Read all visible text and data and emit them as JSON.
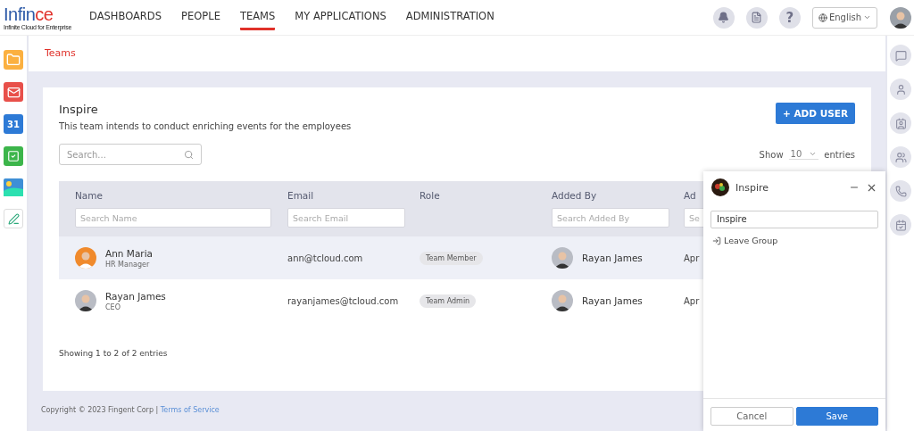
{
  "logo": {
    "main": "Infin",
    "accent": "ce",
    "tagline": "Infinite Cloud for Enterprise"
  },
  "nav": [
    {
      "label": "DASHBOARDS",
      "selected": false
    },
    {
      "label": "PEOPLE",
      "selected": false
    },
    {
      "label": "TEAMS",
      "selected": true
    },
    {
      "label": "MY APPLICATIONS",
      "selected": false
    },
    {
      "label": "ADMINISTRATION",
      "selected": false
    }
  ],
  "header_actions": {
    "help": "?",
    "language": "English"
  },
  "left_apps": [
    {
      "kind": "folder"
    },
    {
      "kind": "mail"
    },
    {
      "kind": "calendar",
      "text": "31"
    },
    {
      "kind": "tasks"
    },
    {
      "kind": "gallery"
    },
    {
      "kind": "learning"
    }
  ],
  "right_apps": [
    {
      "kind": "chat"
    },
    {
      "kind": "person"
    },
    {
      "kind": "contact"
    },
    {
      "kind": "group"
    },
    {
      "kind": "phone"
    },
    {
      "kind": "calendar"
    }
  ],
  "breadcrumb": "Teams",
  "team": {
    "name": "Inspire",
    "description": "This team intends to conduct enriching events for the employees"
  },
  "add_button": "+ ADD USER",
  "search": {
    "placeholder": "Search..."
  },
  "page_size": {
    "before": "Show",
    "value": "10",
    "after": "entries"
  },
  "table": {
    "columns": [
      {
        "label": "Name",
        "filter": "Search Name"
      },
      {
        "label": "Email",
        "filter": "Search Email"
      },
      {
        "label": "Role"
      },
      {
        "label": "Added By",
        "filter": "Search Added By"
      },
      {
        "label": "Ad",
        "filter": "Se"
      }
    ],
    "rows": [
      {
        "name": "Ann Maria",
        "title": "HR Manager",
        "email": "ann@tcloud.com",
        "role": "Team Member",
        "added_by": "Rayan James",
        "column_5": "Apr",
        "selected": true
      },
      {
        "name": "Rayan James",
        "title": "CEO",
        "email": "rayanjames@tcloud.com",
        "role": "Team Admin",
        "added_by": "Rayan James",
        "column_5": "Apr",
        "selected": false
      }
    ]
  },
  "showing": "Showing 1 to 2 of 2 entries",
  "footer": {
    "copyright": "Copyright © 2023 Fingent Corp |",
    "link": "Terms of Service"
  },
  "chat_panel": {
    "title": "Inspire",
    "name_value": "Inspire",
    "action": "Leave Group",
    "cancel": "Cancel",
    "save": "Save"
  }
}
